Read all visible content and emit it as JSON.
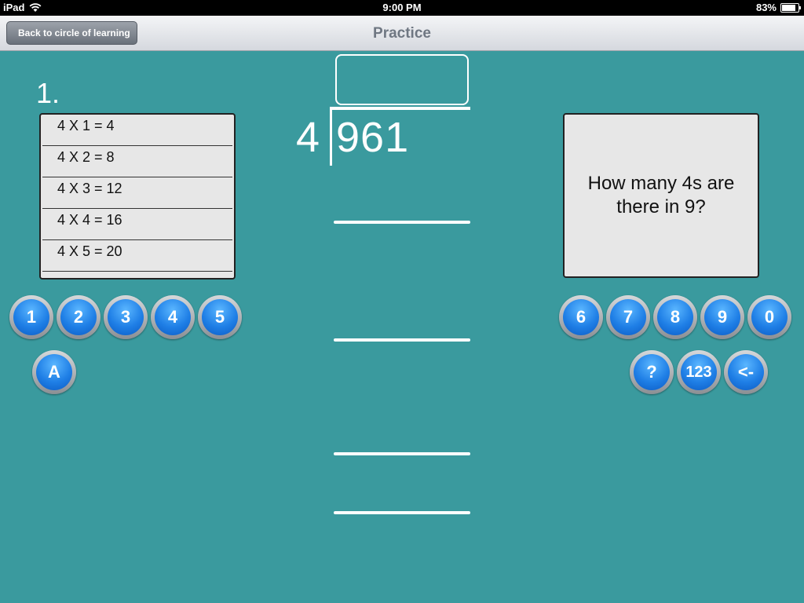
{
  "status_bar": {
    "device": "iPad",
    "time": "9:00 PM",
    "battery_percent": "83%",
    "battery_level": 0.83
  },
  "nav": {
    "title": "Practice",
    "back_label": "Back to circle of learning"
  },
  "problem": {
    "number": "1.",
    "divisor": "4",
    "dividend": "961",
    "quotient": ""
  },
  "times_table": [
    "4 X 1 = 4",
    "4 X 2 = 8",
    "4 X 3 = 12",
    "4 X 4 = 16",
    "4 X 5 = 20"
  ],
  "hint": "How many 4s are there in 9?",
  "keypad": {
    "left_row1": [
      "1",
      "2",
      "3",
      "4",
      "5"
    ],
    "left_row2": [
      "A"
    ],
    "right_row1": [
      "6",
      "7",
      "8",
      "9",
      "0"
    ],
    "right_row2": [
      "?",
      "123",
      "<-"
    ]
  }
}
